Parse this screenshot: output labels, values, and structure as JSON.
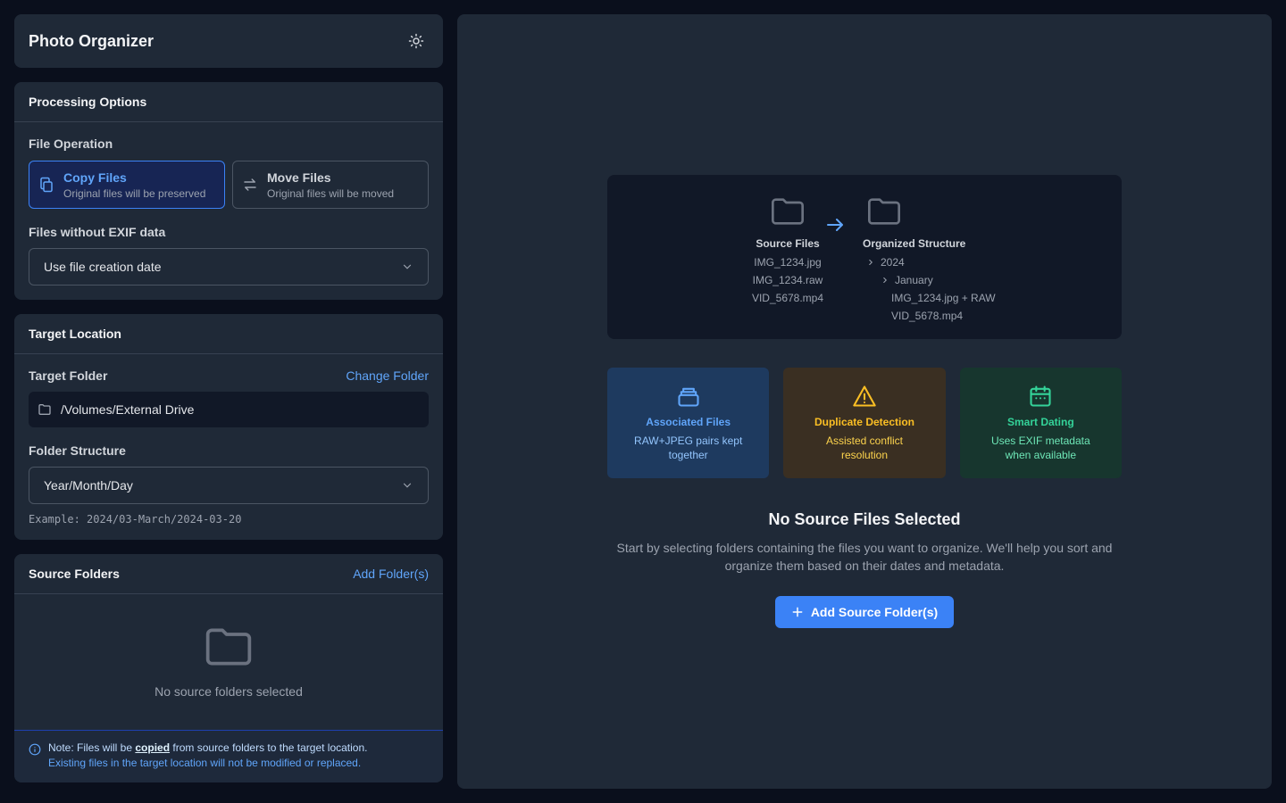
{
  "app": {
    "title": "Photo Organizer",
    "theme_icon": "sun-icon"
  },
  "processing": {
    "title": "Processing Options",
    "file_operation_label": "File Operation",
    "copy": {
      "title": "Copy Files",
      "desc": "Original files will be preserved",
      "selected": true
    },
    "move": {
      "title": "Move Files",
      "desc": "Original files will be moved",
      "selected": false
    },
    "exif_label": "Files without EXIF data",
    "exif_value": "Use file creation date"
  },
  "target": {
    "title": "Target Location",
    "folder_label": "Target Folder",
    "change_label": "Change Folder",
    "path": "/Volumes/External Drive",
    "structure_label": "Folder Structure",
    "structure_value": "Year/Month/Day",
    "example": "Example: 2024/03-March/2024-03-20"
  },
  "source": {
    "title": "Source Folders",
    "add_label": "Add Folder(s)",
    "empty_text": "No source folders selected"
  },
  "note": {
    "prefix": "Note: Files will be ",
    "emphasis": "copied",
    "suffix": " from source folders to the target location.",
    "line2": "Existing files in the target location will not be modified or replaced."
  },
  "diagram": {
    "source_title": "Source Files",
    "source_files": [
      "IMG_1234.jpg",
      "IMG_1234.raw",
      "VID_5678.mp4"
    ],
    "target_title": "Organized Structure",
    "year": "2024",
    "month": "January",
    "files": [
      "IMG_1234.jpg + RAW",
      "VID_5678.mp4"
    ]
  },
  "features": [
    {
      "title": "Associated Files",
      "desc": "RAW+JPEG pairs kept together",
      "icon": "stack-icon",
      "color": "#60a5fa"
    },
    {
      "title": "Duplicate Detection",
      "desc": "Assisted conflict resolution",
      "icon": "warning-icon",
      "color": "#fbbf24"
    },
    {
      "title": "Smart Dating",
      "desc": "Uses EXIF metadata when available",
      "icon": "calendar-icon",
      "color": "#34d399"
    }
  ],
  "empty_state": {
    "title": "No Source Files Selected",
    "desc": "Start by selecting folders containing the files you want to organize. We'll help you sort and organize them based on their dates and metadata.",
    "cta": "Add Source Folder(s)"
  }
}
